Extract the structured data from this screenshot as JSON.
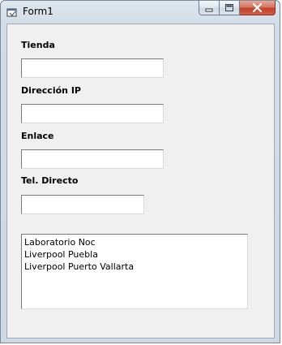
{
  "window": {
    "title": "Form1",
    "icon": "vb-form-icon",
    "buttons": [
      "minimize-icon",
      "maximize-icon",
      "close-icon"
    ]
  },
  "form": {
    "tienda_label": "Tienda",
    "tienda_value": "",
    "ip_label": "Dirección IP",
    "ip_value": "",
    "enlace_label": "Enlace",
    "enlace_value": "",
    "tel_label": "Tel. Directo",
    "tel_value": ""
  },
  "list": {
    "items": [
      "Laboratorio Noc",
      "Liverpool Puebla",
      "Liverpool Puerto Vallarta"
    ]
  },
  "colors": {
    "close_button": "#c7432c",
    "client_bg": "#f0f0f0"
  }
}
